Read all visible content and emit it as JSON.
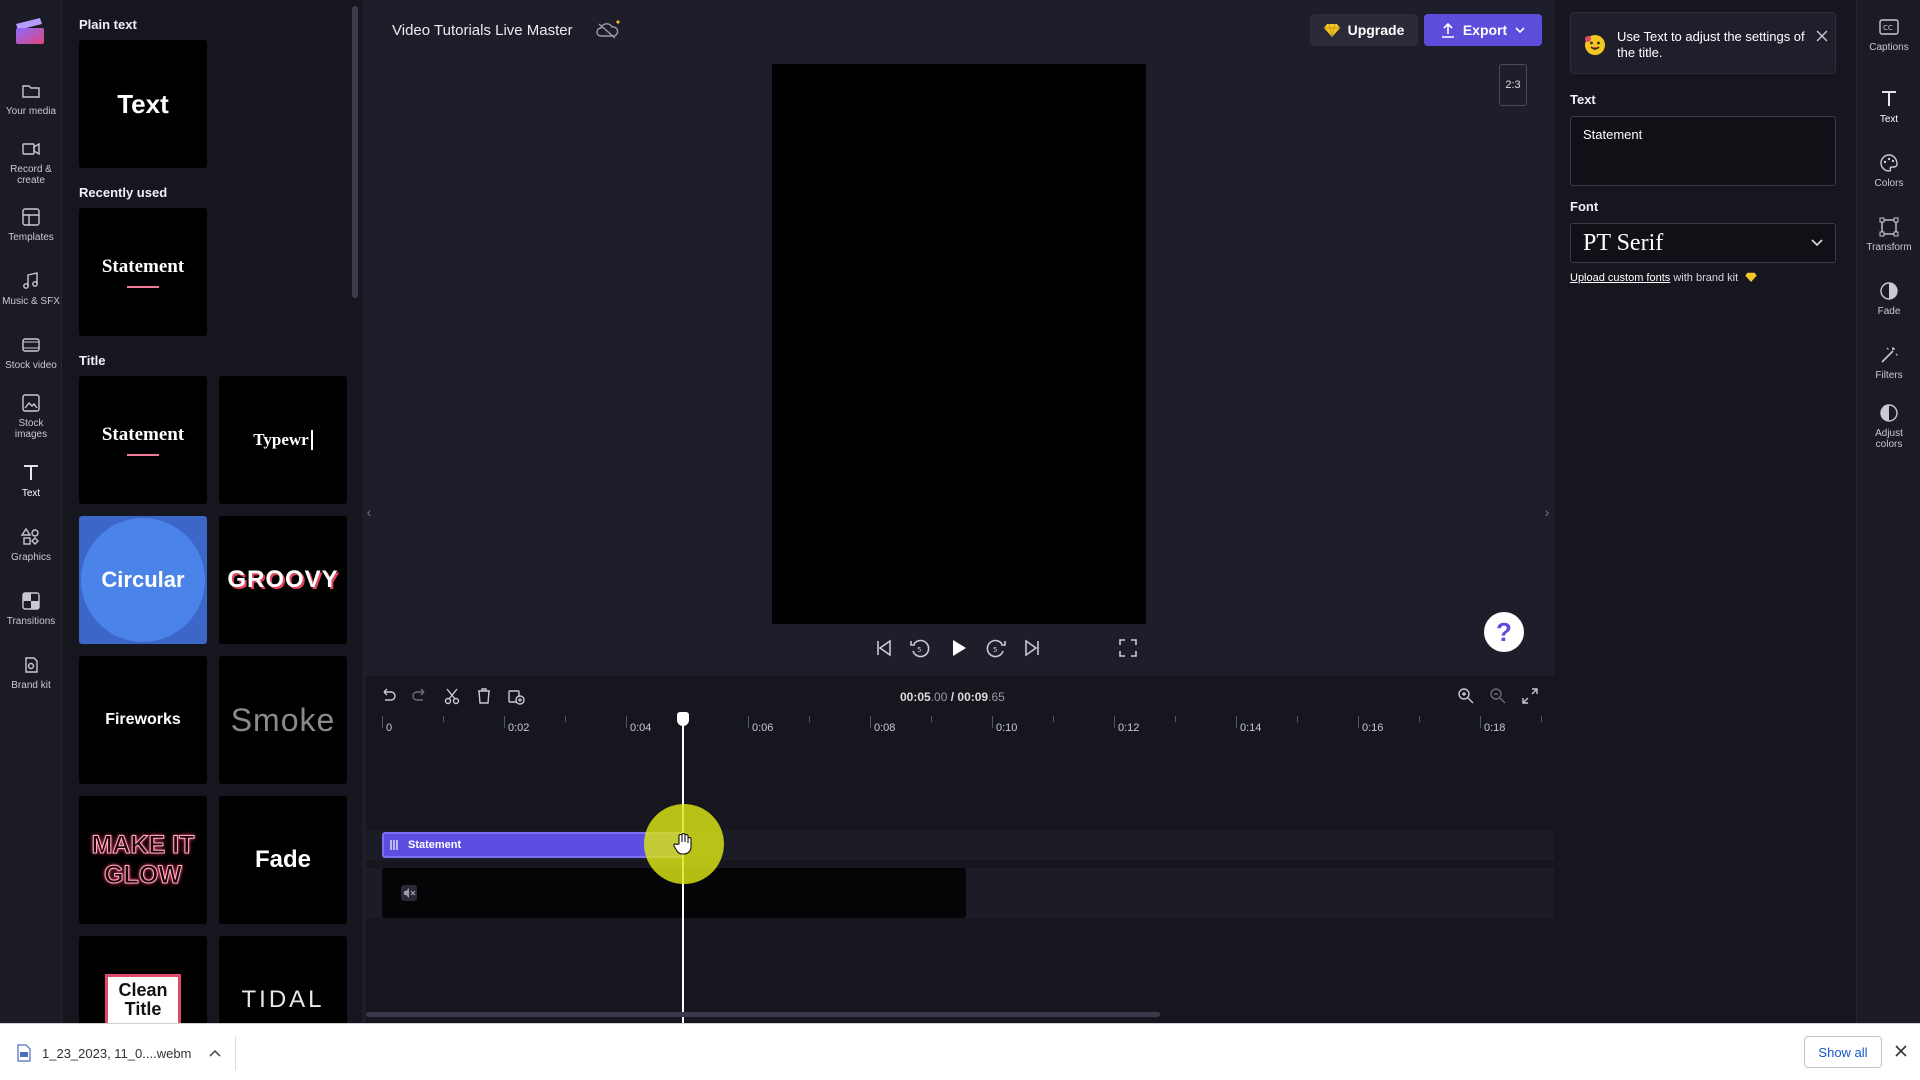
{
  "nav": {
    "items": [
      {
        "label": "Your media"
      },
      {
        "label": "Record & create"
      },
      {
        "label": "Templates"
      },
      {
        "label": "Music & SFX"
      },
      {
        "label": "Stock video"
      },
      {
        "label": "Stock images"
      },
      {
        "label": "Text"
      },
      {
        "label": "Graphics"
      },
      {
        "label": "Transitions"
      },
      {
        "label": "Brand kit"
      }
    ],
    "active": "Text"
  },
  "library": {
    "plain_heading": "Plain text",
    "plain_tile": "Text",
    "recent_heading": "Recently used",
    "recent_tile": "Statement",
    "title_heading": "Title",
    "tiles": {
      "statement": "Statement",
      "typewriter": "Typewr",
      "circular": "Circular",
      "groovy": "GROOVY",
      "fireworks": "Fireworks",
      "smoke": "Smoke",
      "glow_line1": "MAKE IT",
      "glow_line2": "GLOW",
      "fade": "Fade",
      "clean_line1": "Clean",
      "clean_line2": "Title",
      "tidal": "TIDAL"
    }
  },
  "topbar": {
    "project_title": "Video Tutorials Live Master",
    "upgrade_label": "Upgrade",
    "export_label": "Export"
  },
  "preview": {
    "aspect_ratio": "2:3"
  },
  "timeline": {
    "current_time_main": "00:05",
    "current_time_frac": ".00",
    "total_time_main": "00:09",
    "total_time_frac": ".65",
    "separator": " / ",
    "ruler_labels": [
      "0",
      "0:02",
      "0:04",
      "0:06",
      "0:08",
      "0:10",
      "0:12",
      "0:14",
      "0:16",
      "0:18"
    ],
    "text_clip_label": "Statement"
  },
  "properties": {
    "tip_text": "Use Text to adjust the settings of the title.",
    "text_label": "Text",
    "text_value": "Statement",
    "font_label": "Font",
    "font_value": "PT Serif",
    "upload_link": "Upload custom fonts",
    "upload_suffix": " with brand kit"
  },
  "right_rail": {
    "items": [
      {
        "label": "Captions"
      },
      {
        "label": "Text"
      },
      {
        "label": "Colors"
      },
      {
        "label": "Transform"
      },
      {
        "label": "Fade"
      },
      {
        "label": "Filters"
      },
      {
        "label": "Adjust colors"
      }
    ],
    "active": "Text"
  },
  "downloads": {
    "file_name": "1_23_2023, 11_0....webm",
    "show_all_label": "Show all"
  },
  "colors": {
    "accent": "#5c4ddb",
    "clip": "#5b4ee0",
    "halo": "#dce614",
    "premium": "#f3c623"
  }
}
